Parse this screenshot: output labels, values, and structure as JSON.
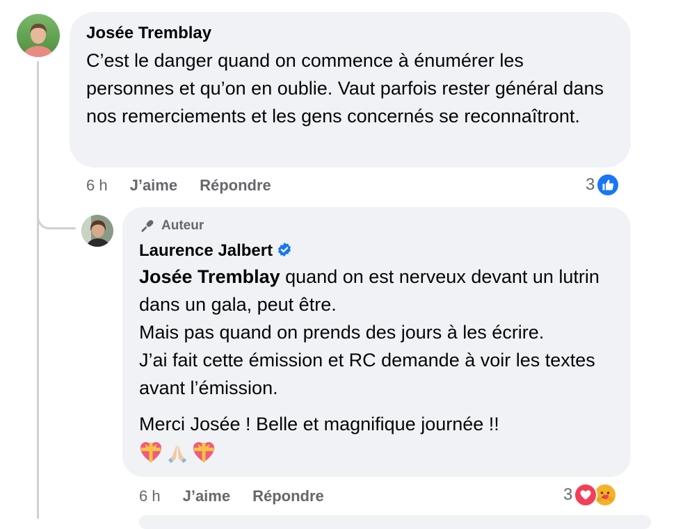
{
  "comment": {
    "author": "Josée Tremblay",
    "text": "C’est le danger quand on commence à énumérer les personnes et qu’on en oublie. Vaut parfois rester général dans nos remerciements et les gens concernés se reconnaîtront.",
    "time": "6 h",
    "like_label": "J’aime",
    "reply_label": "Répondre",
    "reaction_count": "3",
    "reaction_icons": [
      "like-icon"
    ]
  },
  "reply": {
    "badge": "Auteur",
    "author": "Laurence Jalbert",
    "mention": "Josée Tremblay",
    "text_lines": [
      " quand on est nerveux devant un lutrin dans un gala, peut être.",
      "Mais pas quand on prends des jours à les écrire.",
      "J’ai fait cette émission et RC demande à voir les textes avant l’émission."
    ],
    "closing": "Merci Josée ! Belle et magnifique journée !!",
    "emojis": [
      "heart-with-ribbon",
      "folded-hands",
      "heart-with-ribbon"
    ],
    "time": "6 h",
    "like_label": "J’aime",
    "reply_label": "Répondre",
    "reaction_count": "3",
    "reaction_icons": [
      "love-icon",
      "care-icon"
    ]
  },
  "colors": {
    "bubble": "#f0f2f5",
    "meta_text": "#65676b",
    "like_blue": "#1877f2",
    "love_red": "#f33e58",
    "care_yellow": "#f7b125",
    "verified_blue": "#1877f2"
  }
}
